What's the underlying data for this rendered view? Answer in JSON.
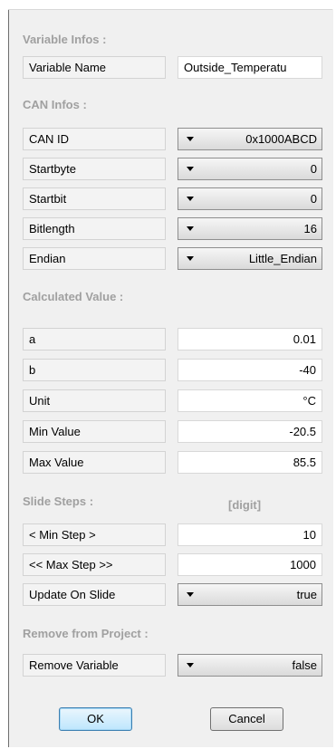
{
  "sections": {
    "variable_infos": "Variable Infos :",
    "can_infos": "CAN Infos :",
    "calculated_value": "Calculated Value :",
    "slide_steps": "Slide Steps :",
    "remove_from_project": "Remove from Project :"
  },
  "variable": {
    "name_label": "Variable Name",
    "name_value": "Outside_Temperatu"
  },
  "can": {
    "id_label": "CAN ID",
    "id_value": "0x1000ABCD",
    "startbyte_label": "Startbyte",
    "startbyte_value": "0",
    "startbit_label": "Startbit",
    "startbit_value": "0",
    "bitlength_label": "Bitlength",
    "bitlength_value": "16",
    "endian_label": "Endian",
    "endian_value": "Little_Endian"
  },
  "calc": {
    "a_label": "a",
    "a_value": "0.01",
    "b_label": "b",
    "b_value": "-40",
    "unit_label": "Unit",
    "unit_value": "°C",
    "min_label": "Min Value",
    "min_value": "-20.5",
    "max_label": "Max Value",
    "max_value": "85.5"
  },
  "slide": {
    "unit_hint": "[digit]",
    "min_step_label": "<   Min Step   >",
    "min_step_value": "10",
    "max_step_label": "<< Max Step >>",
    "max_step_value": "1000",
    "update_label": "Update On Slide",
    "update_value": "true"
  },
  "remove": {
    "label": "Remove Variable",
    "value": "false"
  },
  "buttons": {
    "ok": "OK",
    "cancel": "Cancel"
  }
}
